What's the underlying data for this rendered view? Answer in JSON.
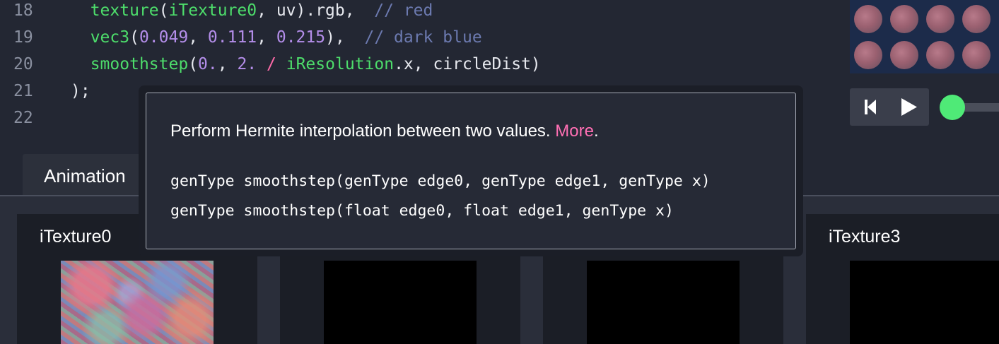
{
  "editor": {
    "lines": [
      {
        "num": "18",
        "tokens": [
          {
            "t": "texture",
            "c": "fn"
          },
          {
            "t": "(",
            "c": "pl"
          },
          {
            "t": "iTexture0",
            "c": "id"
          },
          {
            "t": ", uv).rgb,  ",
            "c": "pl"
          },
          {
            "t": "// red",
            "c": "cm"
          }
        ]
      },
      {
        "num": "19",
        "tokens": [
          {
            "t": "vec3",
            "c": "fn"
          },
          {
            "t": "(",
            "c": "pl"
          },
          {
            "t": "0.049",
            "c": "num"
          },
          {
            "t": ", ",
            "c": "pl"
          },
          {
            "t": "0.111",
            "c": "num"
          },
          {
            "t": ", ",
            "c": "pl"
          },
          {
            "t": "0.215",
            "c": "num"
          },
          {
            "t": "),  ",
            "c": "pl"
          },
          {
            "t": "// dark blue",
            "c": "cm"
          }
        ]
      },
      {
        "num": "20",
        "tokens": [
          {
            "t": "smoothstep",
            "c": "fn"
          },
          {
            "t": "(",
            "c": "pl"
          },
          {
            "t": "0.",
            "c": "num"
          },
          {
            "t": ", ",
            "c": "pl"
          },
          {
            "t": "2.",
            "c": "num"
          },
          {
            "t": " ",
            "c": "pl"
          },
          {
            "t": "/",
            "c": "op"
          },
          {
            "t": " ",
            "c": "pl"
          },
          {
            "t": "iResolution",
            "c": "id"
          },
          {
            "t": ".x, circleDist)",
            "c": "pl"
          }
        ]
      },
      {
        "num": "21",
        "tokens": [
          {
            "t": ");",
            "c": "pl"
          }
        ]
      },
      {
        "num": "22",
        "tokens": []
      }
    ]
  },
  "tooltip": {
    "description": "Perform Hermite interpolation between two values.",
    "more_label": "More",
    "period": ".",
    "signatures": [
      "genType smoothstep(genType edge0, genType edge1, genType x)",
      "genType smoothstep(float edge0, float edge1, genType x)"
    ]
  },
  "tabs": {
    "animation_label": "Animation"
  },
  "textures": [
    {
      "title": "iTexture0"
    },
    {
      "title": ""
    },
    {
      "title": ""
    },
    {
      "title": "iTexture3"
    }
  ],
  "colors": {
    "accent_green": "#4fea77",
    "link_pink": "#ff6fb4",
    "background": "#232733"
  },
  "icons": {
    "restart": "skip-back-icon",
    "play": "play-icon"
  }
}
